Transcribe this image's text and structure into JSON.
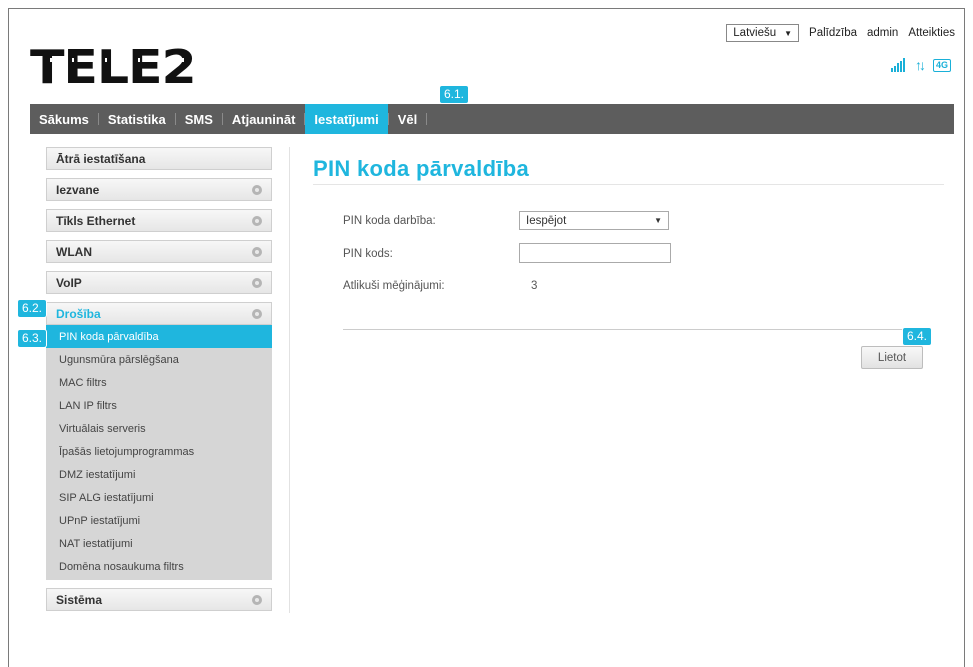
{
  "brand": {
    "logo_text": "TELE2",
    "accent_color": "#1fb6de"
  },
  "topbar": {
    "language": "Latviešu",
    "help": "Palīdzība",
    "user": "admin",
    "logout": "Atteikties"
  },
  "status_icons": [
    "signal-strength-icon",
    "data-transfer-icon",
    "network-4g-icon"
  ],
  "status": {
    "network_type": "4G"
  },
  "nav": {
    "items": [
      "Sākums",
      "Statistika",
      "SMS",
      "Atjaunināt",
      "Iestatījumi",
      "Vēl"
    ],
    "active": "Iestatījumi"
  },
  "callouts": {
    "c61": "6.1.",
    "c62": "6.2.",
    "c63": "6.3.",
    "c64": "6.4."
  },
  "sidebar": {
    "sections": [
      "Ātrā iestatīšana",
      "Iezvane",
      "Tīkls Ethernet",
      "WLAN",
      "VoIP",
      "Drošība",
      "Sistēma"
    ],
    "open_section": "Drošība",
    "subitems": [
      "PIN koda pārvaldība",
      "Ugunsmūra pārslēgšana",
      "MAC filtrs",
      "LAN IP filtrs",
      "Virtuālais serveris",
      "Īpašās lietojumprogrammas",
      "DMZ iestatījumi",
      "SIP ALG iestatījumi",
      "UPnP iestatījumi",
      "NAT iestatījumi",
      "Domēna nosaukuma filtrs"
    ],
    "active_subitem": "PIN koda pārvaldība"
  },
  "main": {
    "title": "PIN koda pārvaldība",
    "form": {
      "action_label": "PIN koda darbība:",
      "action_value": "Iespējot",
      "pin_label": "PIN kods:",
      "pin_value": "",
      "attempts_label": "Atlikuši mēģinājumi:",
      "attempts_value": "3"
    },
    "apply_button": "Lietot"
  }
}
